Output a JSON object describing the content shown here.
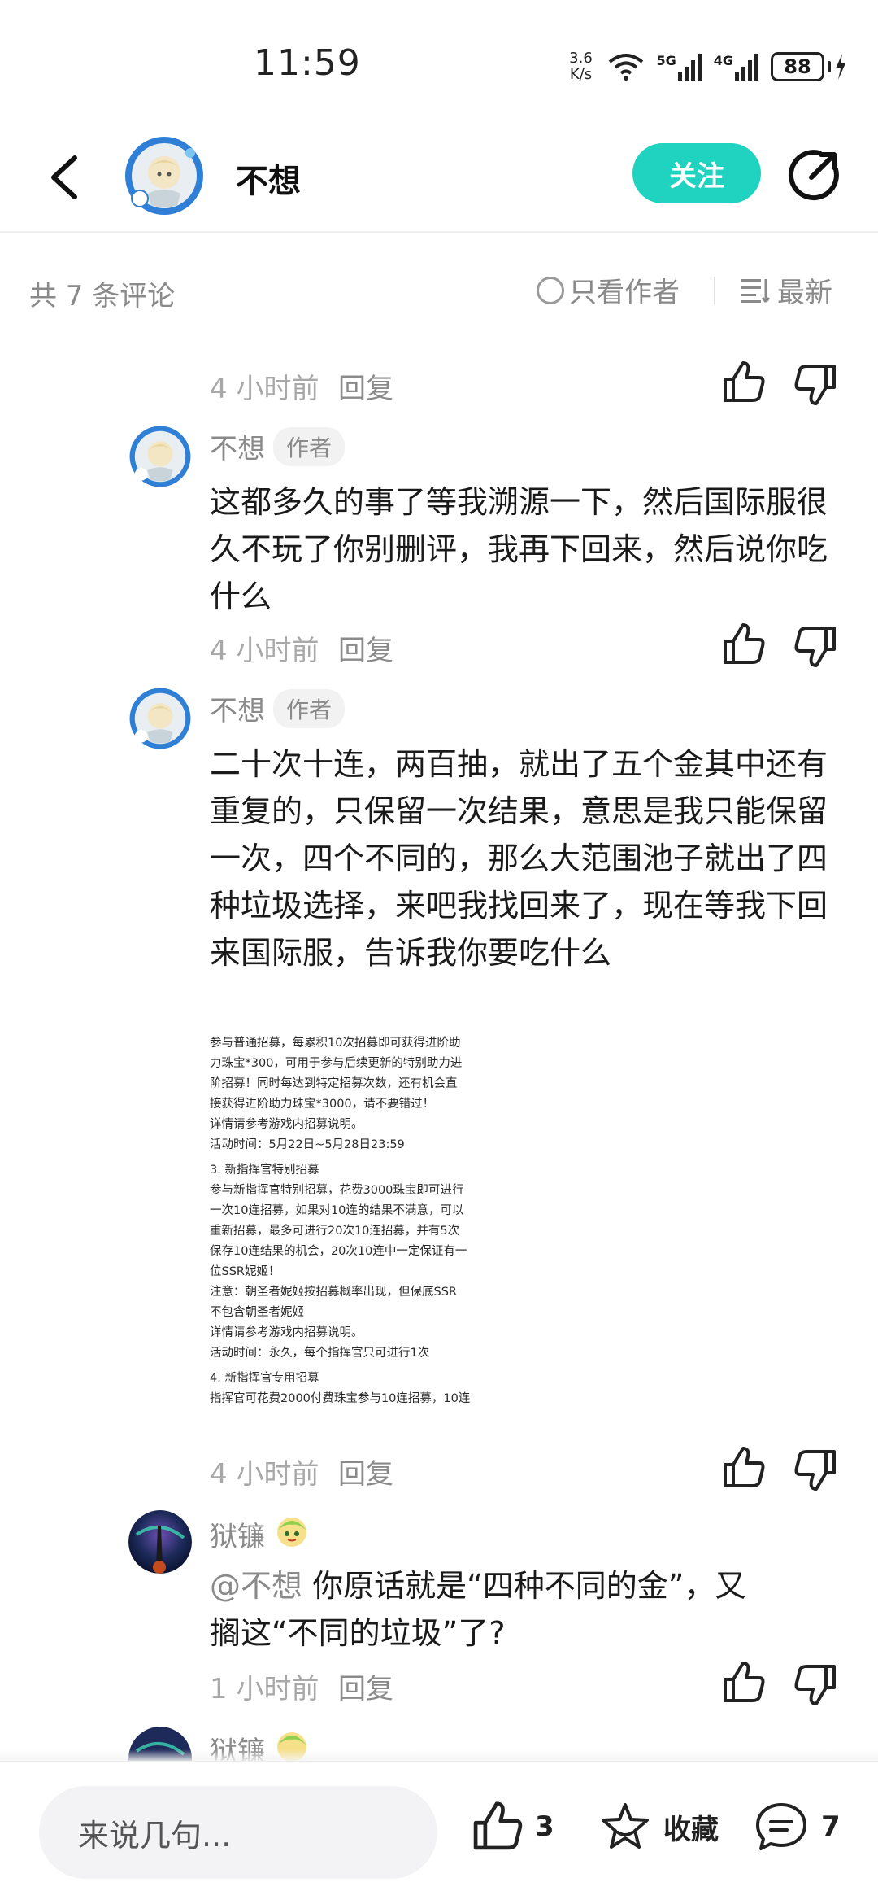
{
  "status_bar": {
    "time": "11:59",
    "net_speed_value": "3.6",
    "net_speed_unit": "K/s",
    "signal_1_label": "5G",
    "signal_2_label": "4G",
    "battery": "88"
  },
  "header": {
    "username": "不想",
    "follow_label": "关注"
  },
  "filter": {
    "comment_count": "共 7 条评论",
    "author_only": "只看作者",
    "sort": "最新"
  },
  "comments": [
    {
      "time": "4 小时前",
      "reply": "回复"
    },
    {
      "user": "不想",
      "badge": "作者",
      "text": "这都多久的事了等我溯源一下，然后国际服很久不玩了你别删评，我再下回来，然后说你吃什么",
      "time": "4 小时前",
      "reply": "回复"
    },
    {
      "user": "不想",
      "badge": "作者",
      "text": "二十次十连，两百抽，就出了五个金其中还有重复的，只保留一次结果，意思是我只能保留一次，四个不同的，那么大范围池子就出了四种垃圾选择，来吧我找回来了，现在等我下回来国际服，告诉我你要吃什么",
      "image_lines": [
        "参与普通招募，每累积10次招募即可获得进阶助",
        "力珠宝*300，可用于参与后续更新的特别助力进",
        "阶招募！同时每达到特定招募次数，还有机会直",
        "接获得进阶助力珠宝*3000，请不要错过！",
        "详情请参考游戏内招募说明。",
        "活动时间：5月22日~5月28日23:59",
        "3. 新指挥官特别招募",
        "参与新指挥官特别招募，花费3000珠宝即可进行",
        "一次10连招募，如果对10连的结果不满意，可以",
        "重新招募，最多可进行20次10连招募，并有5次",
        "保存10连结果的机会，20次10连中一定保证有一",
        "位SSR妮姬！",
        "注意：朝圣者妮姬按招募概率出现，但保底SSR",
        "不包含朝圣者妮姬",
        "详情请参考游戏内招募说明。",
        "活动时间：永久，每个指挥官只可进行1次",
        "4. 新指挥官专用招募",
        "指挥官可花费2000付费珠宝参与10连招募，10连"
      ],
      "time": "4 小时前",
      "reply": "回复"
    },
    {
      "user": "狱镰",
      "mention": "@不想",
      "text_line1": " 你原话就是“四种不同的金”，又",
      "text_line2": "搁这“不同的垃圾”了?",
      "time": "1 小时前",
      "reply": "回复"
    },
    {
      "user": "狱镰"
    }
  ],
  "bottom": {
    "input_placeholder": "来说几句...",
    "like_count": "3",
    "favorite_label": "收藏",
    "comment_count": "7"
  },
  "colors": {
    "accent": "#20d3c0",
    "muted_text": "#8a8a8a",
    "time_text": "#a8a8a8"
  }
}
